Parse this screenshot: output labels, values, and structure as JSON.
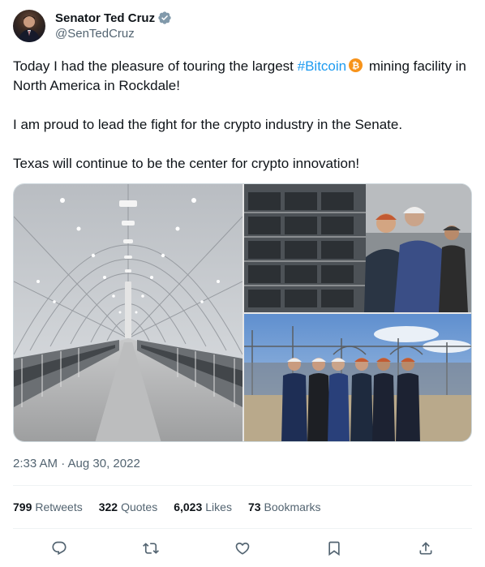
{
  "author": {
    "display_name": "Senator Ted Cruz",
    "handle": "@SenTedCruz",
    "verified": true,
    "verified_color": "#829aab"
  },
  "tweet": {
    "line1_before": "Today I had the pleasure of touring the largest ",
    "hashtag": "#Bitcoin",
    "line1_after": " mining facility in North America in Rockdale!",
    "para2": "I am proud to lead the fight for the crypto industry in the Senate.",
    "para3": "Texas will continue to be the center for crypto innovation!"
  },
  "timestamp": "2:33 AM · Aug 30, 2022",
  "stats": [
    {
      "count": "799",
      "label": "Retweets"
    },
    {
      "count": "322",
      "label": "Quotes"
    },
    {
      "count": "6,023",
      "label": "Likes"
    },
    {
      "count": "73",
      "label": "Bookmarks"
    }
  ],
  "actions": [
    "reply-icon",
    "retweet-icon",
    "like-icon",
    "bookmark-icon",
    "share-icon"
  ],
  "colors": {
    "text": "#0f1419",
    "secondary": "#536471",
    "link": "#1d9bf0",
    "bitcoin": "#f7931a",
    "divider": "#eff3f4"
  }
}
